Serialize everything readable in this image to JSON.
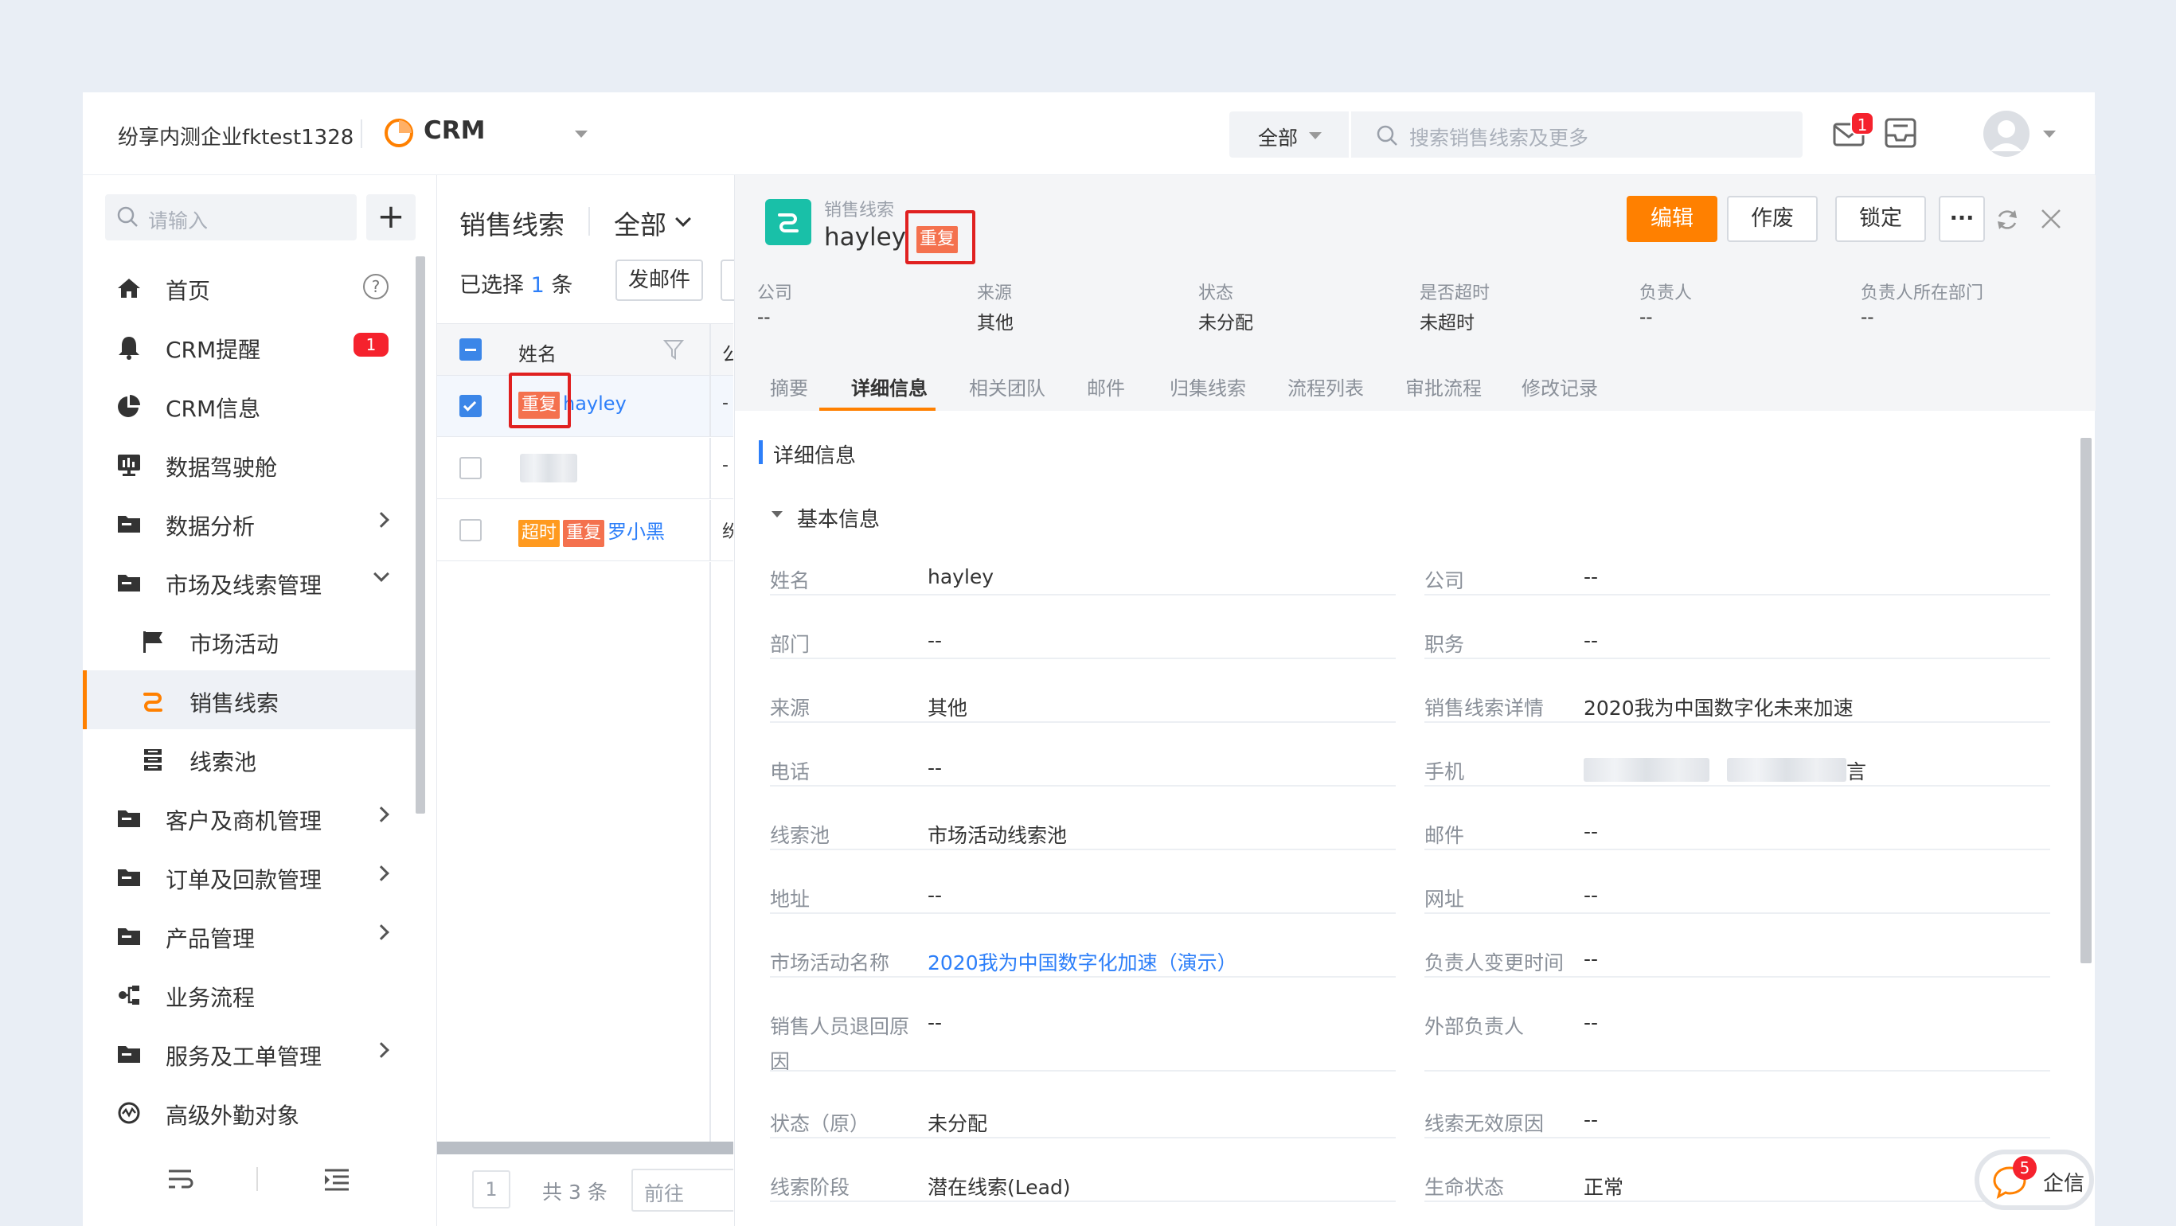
{
  "header": {
    "org_name": "纷享内测企业fktest1328",
    "app_name": "CRM",
    "scope_filter": "全部",
    "search_placeholder": "搜索销售线索及更多",
    "mail_badge": "1"
  },
  "sidebar": {
    "search_placeholder": "请输入",
    "add_label": "+",
    "items": [
      {
        "label": "首页",
        "icon": "home-icon"
      },
      {
        "label": "CRM提醒",
        "icon": "bell-icon",
        "badge": "1"
      },
      {
        "label": "CRM信息",
        "icon": "pie-icon"
      },
      {
        "label": "数据驾驶舱",
        "icon": "dashboard-icon"
      },
      {
        "label": "数据分析",
        "icon": "folder-icon"
      },
      {
        "label": "市场及线索管理",
        "icon": "folder-icon"
      },
      {
        "label": "市场活动",
        "icon": "flag-icon"
      },
      {
        "label": "销售线索",
        "icon": "lead-icon"
      },
      {
        "label": "线索池",
        "icon": "pool-icon"
      },
      {
        "label": "客户及商机管理",
        "icon": "folder-icon"
      },
      {
        "label": "订单及回款管理",
        "icon": "folder-icon"
      },
      {
        "label": "产品管理",
        "icon": "folder-icon"
      },
      {
        "label": "业务流程",
        "icon": "flow-icon"
      },
      {
        "label": "服务及工单管理",
        "icon": "folder-icon"
      },
      {
        "label": "高级外勤对象",
        "icon": "field-icon"
      }
    ]
  },
  "list": {
    "title": "销售线索",
    "scope": "全部",
    "selected_prefix": "已选择",
    "selected_count": "1",
    "selected_suffix": "条",
    "send_mail": "发邮件",
    "col_name": "姓名",
    "col_next": "公",
    "rows": [
      {
        "tags": [
          "重复"
        ],
        "name": "hayley",
        "next": "-",
        "checked": true
      },
      {
        "tags": [],
        "name": "",
        "next": "-",
        "checked": false
      },
      {
        "tags": [
          "超时",
          "重复"
        ],
        "name": "罗小黑",
        "next": "纷",
        "checked": false
      }
    ],
    "page": "1",
    "total": "共 3 条",
    "goto": "前往"
  },
  "detail": {
    "object_type": "销售线索",
    "name": "hayley",
    "dup_tag": "重复",
    "buttons": {
      "edit": "编辑",
      "void": "作废",
      "lock": "锁定",
      "more": "···"
    },
    "summary": [
      {
        "label": "公司",
        "value": "--"
      },
      {
        "label": "来源",
        "value": "其他"
      },
      {
        "label": "状态",
        "value": "未分配"
      },
      {
        "label": "是否超时",
        "value": "未超时"
      },
      {
        "label": "负责人",
        "value": "--"
      },
      {
        "label": "负责人所在部门",
        "value": "--"
      }
    ],
    "tabs": [
      "摘要",
      "详细信息",
      "相关团队",
      "邮件",
      "归集线索",
      "流程列表",
      "审批流程",
      "修改记录"
    ],
    "section_title": "详细信息",
    "group_title": "基本信息",
    "fields_left": [
      {
        "label": "姓名",
        "value": "hayley"
      },
      {
        "label": "部门",
        "value": "--"
      },
      {
        "label": "来源",
        "value": "其他"
      },
      {
        "label": "电话",
        "value": "--"
      },
      {
        "label": "线索池",
        "value": "市场活动线索池"
      },
      {
        "label": "地址",
        "value": "--"
      },
      {
        "label": "市场活动名称",
        "value": "2020我为中国数字化加速（演示）"
      },
      {
        "label": "销售人员退回原",
        "label2": "因",
        "value": "--"
      },
      {
        "label": "状态（原）",
        "value": "未分配"
      },
      {
        "label": "线索阶段",
        "value": "潜在线索(Lead)"
      }
    ],
    "fields_right": [
      {
        "label": "公司",
        "value": "--"
      },
      {
        "label": "职务",
        "value": "--"
      },
      {
        "label": "销售线索详情",
        "value": "2020我为中国数字化未来加速"
      },
      {
        "label": "手机",
        "value": "言"
      },
      {
        "label": "邮件",
        "value": "--"
      },
      {
        "label": "网址",
        "value": "--"
      },
      {
        "label": "负责人变更时间",
        "value": "--"
      },
      {
        "label": "外部负责人",
        "value": "--"
      },
      {
        "label": "线索无效原因",
        "value": "--"
      },
      {
        "label": "生命状态",
        "value": "正常"
      }
    ]
  },
  "qixin": {
    "label": "企信",
    "badge": "5"
  },
  "colors": {
    "accent": "#ff8000",
    "link": "#2d7ff9",
    "tag_red": "#f4714e",
    "tag_orange": "#ff9a1f",
    "logo": "#19c0a8",
    "annotation": "#e02020"
  }
}
